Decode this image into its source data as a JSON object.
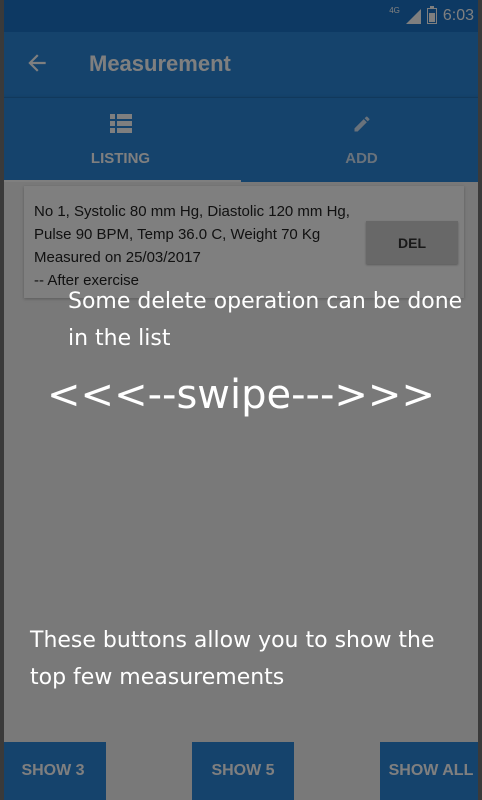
{
  "status_bar": {
    "network": "4G",
    "time": "6:03"
  },
  "toolbar": {
    "title": "Measurement"
  },
  "tabs": [
    {
      "label": "LISTING",
      "icon": "list-icon",
      "selected": true
    },
    {
      "label": "ADD",
      "icon": "pencil-icon",
      "selected": false
    }
  ],
  "measurements": [
    {
      "line1": "No 1,  Systolic 80 mm Hg,  Diastolic 120 mm Hg,",
      "line2": "Pulse 90 BPM,  Temp 36.0 C,  Weight 70 Kg",
      "line3": "Measured on 25/03/2017",
      "line4": "-- After exercise",
      "delete_label": "DEL"
    }
  ],
  "bottom_buttons": {
    "show3": "SHOW 3",
    "show5": "SHOW 5",
    "show_all": "SHOW ALL"
  },
  "tutorial": {
    "delete_hint": "Some delete operation can be done in the list",
    "swipe_hint": "<<<--swipe--->>>",
    "buttons_hint": "These buttons allow you to show the top few measurements"
  },
  "colors": {
    "primary": "#2a86d9",
    "status_bar": "#1a72c6",
    "overlay": "rgba(0,0,0,0.5)"
  }
}
